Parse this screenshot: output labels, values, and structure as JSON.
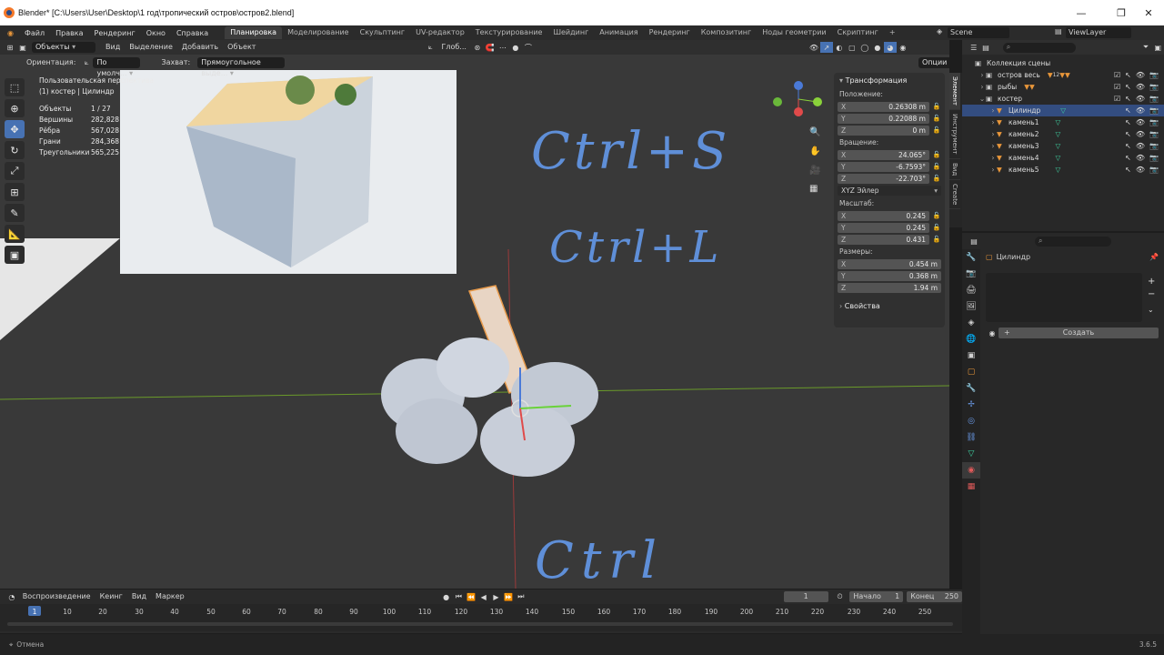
{
  "window": {
    "title": "Blender* [C:\\Users\\User\\Desktop\\1 год\\тропический остров\\остров2.blend]",
    "minimize": "—",
    "maximize": "❐",
    "close": "✕"
  },
  "menubar": {
    "menus": [
      "Файл",
      "Правка",
      "Рендеринг",
      "Окно",
      "Справка"
    ],
    "workspaces": [
      "Планировка",
      "Моделирование",
      "Скульптинг",
      "UV-редактор",
      "Текстурирование",
      "Шейдинг",
      "Анимация",
      "Рендеринг",
      "Композитинг",
      "Ноды геометрии",
      "Скриптинг"
    ],
    "active_workspace": "Планировка",
    "add_tab": "+",
    "scene": "Scene",
    "view_layer": "ViewLayer"
  },
  "viewport": {
    "mode": "Объекты",
    "menus": [
      "Вид",
      "Выделение",
      "Добавить",
      "Объект"
    ],
    "transform_orientation": "Глоб...",
    "orientation_label": "Ориентация:",
    "orientation_value": "По умолч...",
    "snap_label": "Захват:",
    "snap_value": "Прямоугольное выде...",
    "options": "Опции",
    "view_name": "Пользовательская перспектива",
    "collection_object": "(1) костер | Цилиндр",
    "stats": [
      {
        "label": "Объекты",
        "value": "1 / 27"
      },
      {
        "label": "Вершины",
        "value": "282,828"
      },
      {
        "label": "Рёбра",
        "value": "567,028"
      },
      {
        "label": "Грани",
        "value": "284,368"
      },
      {
        "label": "Треугольники",
        "value": "565,225"
      }
    ],
    "handwriting": [
      "Ctrl+S",
      "Ctrl+L",
      "Ctrl"
    ]
  },
  "npanel": {
    "section": "Трансформация",
    "location_label": "Положение:",
    "location": [
      {
        "axis": "X",
        "value": "0.26308 m"
      },
      {
        "axis": "Y",
        "value": "0.22088 m"
      },
      {
        "axis": "Z",
        "value": "0 m"
      }
    ],
    "rotation_label": "Вращение:",
    "rotation": [
      {
        "axis": "X",
        "value": "24.065°"
      },
      {
        "axis": "Y",
        "value": "-6.7593°"
      },
      {
        "axis": "Z",
        "value": "-22.703°"
      }
    ],
    "rotation_mode": "XYZ Эйлер",
    "scale_label": "Масштаб:",
    "scale": [
      {
        "axis": "X",
        "value": "0.245"
      },
      {
        "axis": "Y",
        "value": "0.245"
      },
      {
        "axis": "Z",
        "value": "0.431"
      }
    ],
    "dims_label": "Размеры:",
    "dims": [
      {
        "axis": "X",
        "value": "0.454 m"
      },
      {
        "axis": "Y",
        "value": "0.368 m"
      },
      {
        "axis": "Z",
        "value": "1.94 m"
      }
    ],
    "properties_section": "Свойства",
    "tabs": [
      "Элемент",
      "Инструмент",
      "Вид",
      "Create"
    ]
  },
  "outliner": {
    "rows": [
      {
        "name": "Коллекция сцены",
        "level": 0,
        "type": "scene"
      },
      {
        "name": "остров весь",
        "level": 1,
        "type": "collection"
      },
      {
        "name": "рыбы",
        "level": 1,
        "type": "collection"
      },
      {
        "name": "костер",
        "level": 1,
        "type": "collection"
      },
      {
        "name": "Цилиндр",
        "level": 2,
        "type": "mesh",
        "selected": true
      },
      {
        "name": "камень1",
        "level": 2,
        "type": "mesh"
      },
      {
        "name": "камень2",
        "level": 2,
        "type": "mesh"
      },
      {
        "name": "камень3",
        "level": 2,
        "type": "mesh"
      },
      {
        "name": "камень4",
        "level": 2,
        "type": "mesh"
      },
      {
        "name": "камень5",
        "level": 2,
        "type": "mesh"
      }
    ],
    "badge_count": "12"
  },
  "properties": {
    "object_name": "Цилиндр",
    "create_button": "Создать"
  },
  "timeline": {
    "menus": [
      "Воспроизведение",
      "Кеинг",
      "Вид",
      "Маркер"
    ],
    "current_frame": "1",
    "start_label": "Начало",
    "start": "1",
    "end_label": "Конец",
    "end": "250",
    "ticks": [
      "1",
      "10",
      "20",
      "30",
      "40",
      "50",
      "60",
      "70",
      "80",
      "90",
      "100",
      "110",
      "120",
      "130",
      "140",
      "150",
      "160",
      "170",
      "180",
      "190",
      "200",
      "210",
      "220",
      "230",
      "240",
      "250"
    ]
  },
  "status": {
    "left": "Отмена",
    "version": "3.6.5"
  }
}
